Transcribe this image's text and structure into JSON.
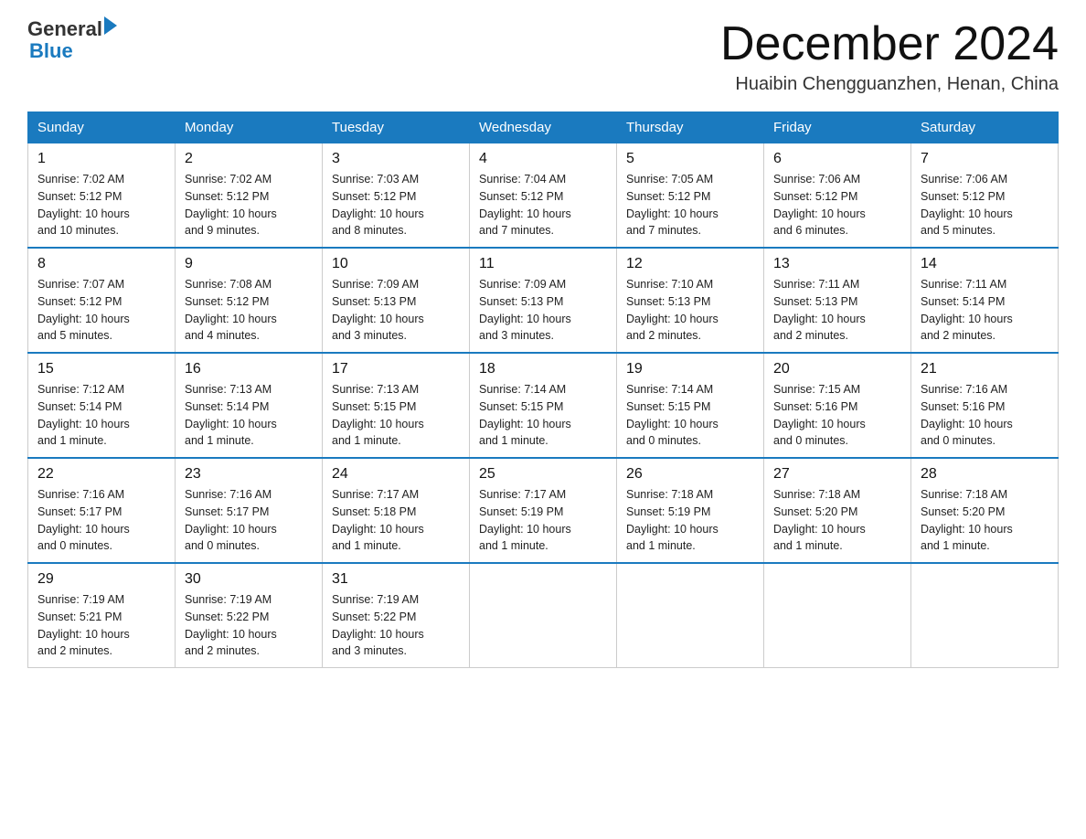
{
  "header": {
    "logo_general": "General",
    "logo_blue": "Blue",
    "month_title": "December 2024",
    "location": "Huaibin Chengguanzhen, Henan, China"
  },
  "days_of_week": [
    "Sunday",
    "Monday",
    "Tuesday",
    "Wednesday",
    "Thursday",
    "Friday",
    "Saturday"
  ],
  "weeks": [
    [
      {
        "day": "1",
        "sunrise": "7:02 AM",
        "sunset": "5:12 PM",
        "daylight": "10 hours and 10 minutes."
      },
      {
        "day": "2",
        "sunrise": "7:02 AM",
        "sunset": "5:12 PM",
        "daylight": "10 hours and 9 minutes."
      },
      {
        "day": "3",
        "sunrise": "7:03 AM",
        "sunset": "5:12 PM",
        "daylight": "10 hours and 8 minutes."
      },
      {
        "day": "4",
        "sunrise": "7:04 AM",
        "sunset": "5:12 PM",
        "daylight": "10 hours and 7 minutes."
      },
      {
        "day": "5",
        "sunrise": "7:05 AM",
        "sunset": "5:12 PM",
        "daylight": "10 hours and 7 minutes."
      },
      {
        "day": "6",
        "sunrise": "7:06 AM",
        "sunset": "5:12 PM",
        "daylight": "10 hours and 6 minutes."
      },
      {
        "day": "7",
        "sunrise": "7:06 AM",
        "sunset": "5:12 PM",
        "daylight": "10 hours and 5 minutes."
      }
    ],
    [
      {
        "day": "8",
        "sunrise": "7:07 AM",
        "sunset": "5:12 PM",
        "daylight": "10 hours and 5 minutes."
      },
      {
        "day": "9",
        "sunrise": "7:08 AM",
        "sunset": "5:12 PM",
        "daylight": "10 hours and 4 minutes."
      },
      {
        "day": "10",
        "sunrise": "7:09 AM",
        "sunset": "5:13 PM",
        "daylight": "10 hours and 3 minutes."
      },
      {
        "day": "11",
        "sunrise": "7:09 AM",
        "sunset": "5:13 PM",
        "daylight": "10 hours and 3 minutes."
      },
      {
        "day": "12",
        "sunrise": "7:10 AM",
        "sunset": "5:13 PM",
        "daylight": "10 hours and 2 minutes."
      },
      {
        "day": "13",
        "sunrise": "7:11 AM",
        "sunset": "5:13 PM",
        "daylight": "10 hours and 2 minutes."
      },
      {
        "day": "14",
        "sunrise": "7:11 AM",
        "sunset": "5:14 PM",
        "daylight": "10 hours and 2 minutes."
      }
    ],
    [
      {
        "day": "15",
        "sunrise": "7:12 AM",
        "sunset": "5:14 PM",
        "daylight": "10 hours and 1 minute."
      },
      {
        "day": "16",
        "sunrise": "7:13 AM",
        "sunset": "5:14 PM",
        "daylight": "10 hours and 1 minute."
      },
      {
        "day": "17",
        "sunrise": "7:13 AM",
        "sunset": "5:15 PM",
        "daylight": "10 hours and 1 minute."
      },
      {
        "day": "18",
        "sunrise": "7:14 AM",
        "sunset": "5:15 PM",
        "daylight": "10 hours and 1 minute."
      },
      {
        "day": "19",
        "sunrise": "7:14 AM",
        "sunset": "5:15 PM",
        "daylight": "10 hours and 0 minutes."
      },
      {
        "day": "20",
        "sunrise": "7:15 AM",
        "sunset": "5:16 PM",
        "daylight": "10 hours and 0 minutes."
      },
      {
        "day": "21",
        "sunrise": "7:16 AM",
        "sunset": "5:16 PM",
        "daylight": "10 hours and 0 minutes."
      }
    ],
    [
      {
        "day": "22",
        "sunrise": "7:16 AM",
        "sunset": "5:17 PM",
        "daylight": "10 hours and 0 minutes."
      },
      {
        "day": "23",
        "sunrise": "7:16 AM",
        "sunset": "5:17 PM",
        "daylight": "10 hours and 0 minutes."
      },
      {
        "day": "24",
        "sunrise": "7:17 AM",
        "sunset": "5:18 PM",
        "daylight": "10 hours and 1 minute."
      },
      {
        "day": "25",
        "sunrise": "7:17 AM",
        "sunset": "5:19 PM",
        "daylight": "10 hours and 1 minute."
      },
      {
        "day": "26",
        "sunrise": "7:18 AM",
        "sunset": "5:19 PM",
        "daylight": "10 hours and 1 minute."
      },
      {
        "day": "27",
        "sunrise": "7:18 AM",
        "sunset": "5:20 PM",
        "daylight": "10 hours and 1 minute."
      },
      {
        "day": "28",
        "sunrise": "7:18 AM",
        "sunset": "5:20 PM",
        "daylight": "10 hours and 1 minute."
      }
    ],
    [
      {
        "day": "29",
        "sunrise": "7:19 AM",
        "sunset": "5:21 PM",
        "daylight": "10 hours and 2 minutes."
      },
      {
        "day": "30",
        "sunrise": "7:19 AM",
        "sunset": "5:22 PM",
        "daylight": "10 hours and 2 minutes."
      },
      {
        "day": "31",
        "sunrise": "7:19 AM",
        "sunset": "5:22 PM",
        "daylight": "10 hours and 3 minutes."
      },
      null,
      null,
      null,
      null
    ]
  ],
  "labels": {
    "sunrise": "Sunrise:",
    "sunset": "Sunset:",
    "daylight": "Daylight:"
  }
}
